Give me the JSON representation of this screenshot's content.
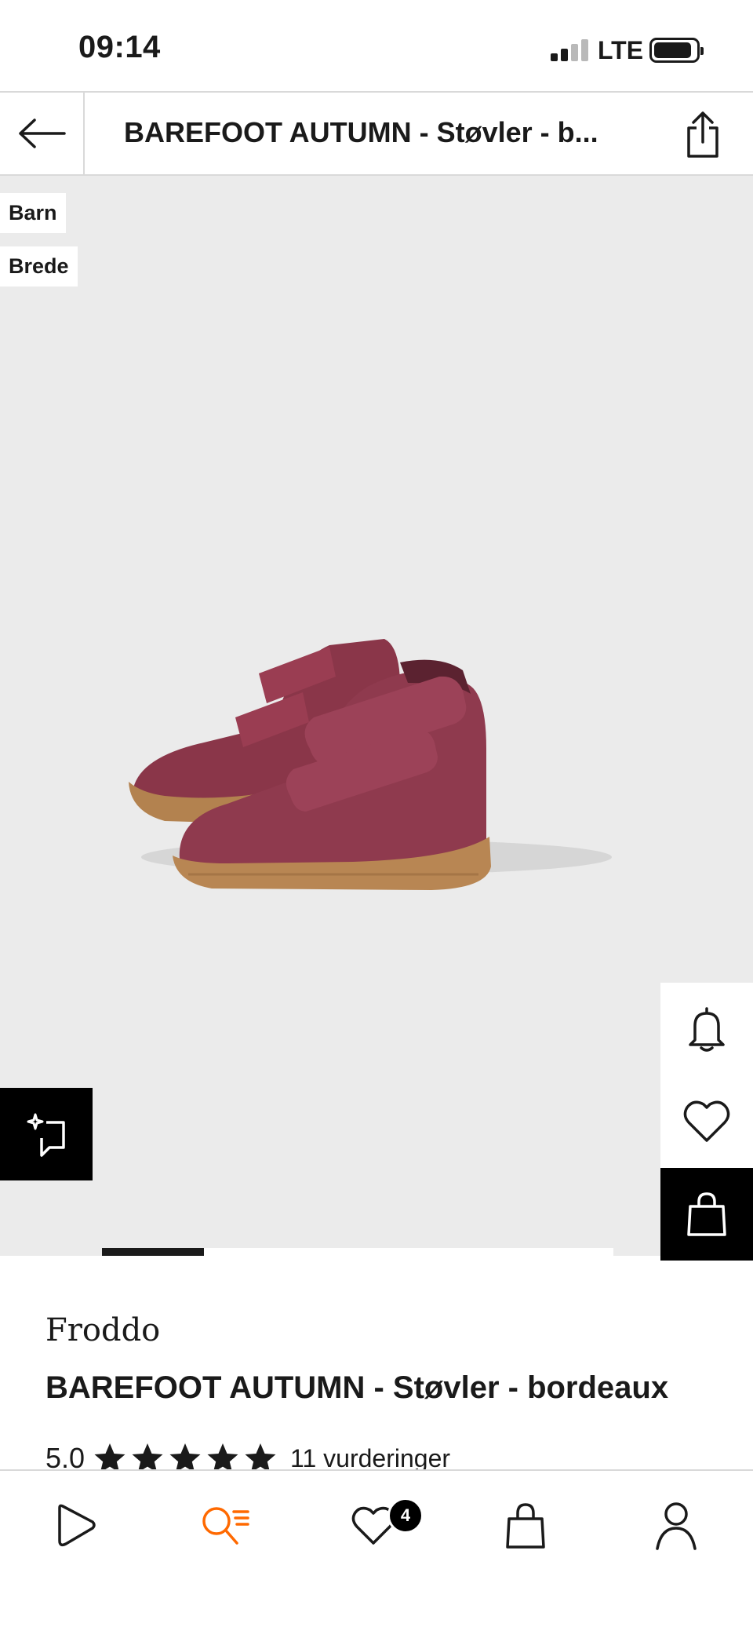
{
  "status_bar": {
    "time": "09:14",
    "network": "LTE"
  },
  "header": {
    "title": "BAREFOOT AUTUMN - Støvler - b..."
  },
  "gallery": {
    "badges": [
      "Barn",
      "Brede"
    ],
    "current_image": 1,
    "shoe_color": "#8f3a4e",
    "sole_color": "#b88653"
  },
  "product": {
    "brand": "Froddo",
    "name": "BAREFOOT AUTUMN - Støvler - bordeaux",
    "rating_value": "5.0",
    "stars": 5,
    "rating_count": "11 vurderinger"
  },
  "bottom_nav": {
    "items": [
      "home-icon",
      "search-icon",
      "wishlist-icon",
      "bag-icon",
      "profile-icon"
    ],
    "active": "search-icon",
    "active_color": "#ff6900",
    "wishlist_count": "4"
  }
}
